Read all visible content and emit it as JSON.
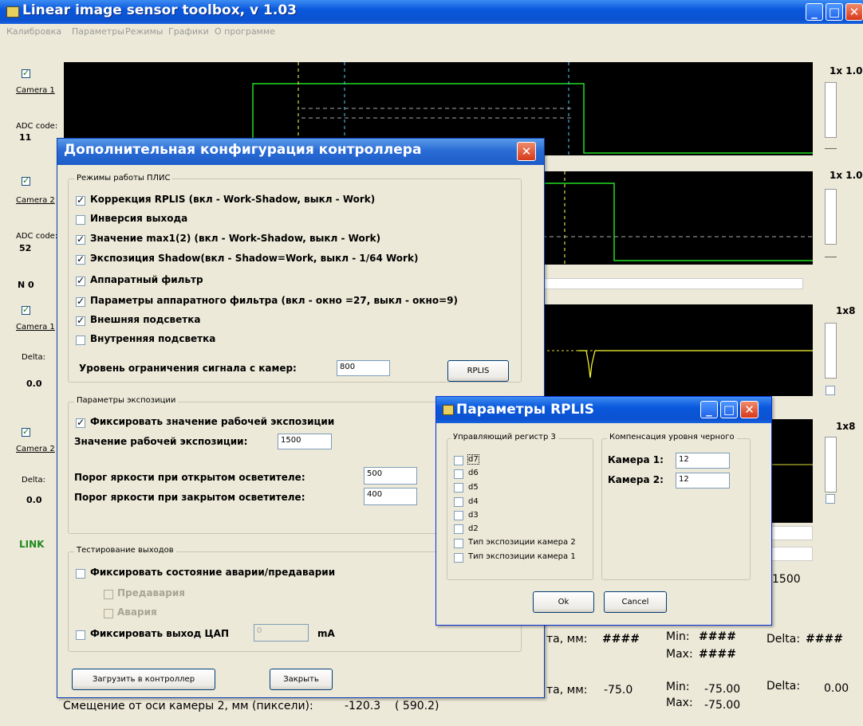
{
  "app": {
    "title": "Linear image sensor toolbox, v 1.03"
  },
  "menu": [
    "Калибровка",
    "Параметры",
    "Режимы",
    "Графики",
    "О программе"
  ],
  "left_panel": {
    "camera1_label": "Camera 1",
    "adc_label": "ADC code:",
    "adc1_value": "11",
    "camera2_label": "Camera 2",
    "adc2_label": "ADC code:",
    "adc2_value": "52",
    "n_label": "N 0",
    "camera1b_label": "Camera 1",
    "delta1_label": "Delta:",
    "delta1_value": "0.0",
    "camera2b_label": "Camera 2",
    "delta2_label": "Delta:",
    "delta2_value": "0.0",
    "link_label": "LINK"
  },
  "scales": {
    "s1": "1x 1.0",
    "s2": "1x 1.0",
    "s3": "1x8",
    "s4": "1x8"
  },
  "results": {
    "r1500": "1500",
    "line1_prefix": "та, мм:",
    "line1_value": "####",
    "min_label": "Min:",
    "max_label": "Max:",
    "line1_min": "####",
    "line1_max": "####",
    "delta_label": "Delta:",
    "line1_delta": "####",
    "line2_prefix": "та, мм:",
    "line2_value": "-75.0",
    "line2_min": "-75.00",
    "line2_max": "-75.00",
    "line2_delta": "0.00",
    "bottom_text": "Смещение от оси камеры 2, мм (пиксели):",
    "bottom_value": "-120.3",
    "bottom_paren": "(   590.2)"
  },
  "config_dialog": {
    "title": "Дополнительная конфигурация контроллера",
    "group1_title": "Режимы работы ПЛИС",
    "options": [
      {
        "label": "Коррекция RPLIS (вкл - Work-Shadow, выкл - Work)",
        "checked": true
      },
      {
        "label": "Инверсия выхода",
        "checked": false
      },
      {
        "label": "Значение max1(2) (вкл - Work-Shadow, выкл - Work)",
        "checked": true
      },
      {
        "label": "Экспозиция Shadow(вкл - Shadow=Work, выкл - 1/64 Work)",
        "checked": true
      },
      {
        "label": "Аппаратный фильтр",
        "checked": true
      },
      {
        "label": "Параметры аппаратного фильтра (вкл - окно =27, выкл - окно=9)",
        "checked": true
      },
      {
        "label": "Внешняя подсветка",
        "checked": true
      },
      {
        "label": "Внутренняя подсветка",
        "checked": false
      }
    ],
    "limit_label": "Уровень ограничения сигнала с камер:",
    "limit_value": "800",
    "rplis_button": "RPLIS",
    "group2_title": "Параметры экспозиции",
    "fix_exposure_label": "Фиксировать значение рабочей экспозиции",
    "fix_exposure_checked": true,
    "work_exposure_label": "Значение рабочей экспозиции:",
    "work_exposure_value": "1500",
    "open_threshold_label": "Порог яркости при открытом осветителе:",
    "open_threshold_value": "500",
    "closed_threshold_label": "Порог яркости при закрытом осветителе:",
    "closed_threshold_value": "400",
    "group3_title": "Тестирование выходов",
    "fix_alarm_label": "Фиксировать состояние аварии/предаварии",
    "prealarm_label": "Предавария",
    "alarm_label": "Авария",
    "fix_dac_label": "Фиксировать выход ЦАП",
    "dac_value": "0",
    "dac_unit": "mA",
    "load_button": "Загрузить в контроллер",
    "close_button": "Закрыть"
  },
  "rplis_dialog": {
    "title": "Параметры RPLIS",
    "reg_group_title": "Управляющий регистр 3",
    "bits": [
      "d7",
      "d6",
      "d5",
      "d4",
      "d3",
      "d2",
      "Тип экспозиции камера 2",
      "Тип экспозиции камера 1"
    ],
    "black_group_title": "Компенсация уровня черного",
    "camera1_label": "Камера 1:",
    "camera1_value": "12",
    "camera2_label": "Камера 2:",
    "camera2_value": "12",
    "ok_button": "Ok",
    "cancel_button": "Cancel"
  }
}
